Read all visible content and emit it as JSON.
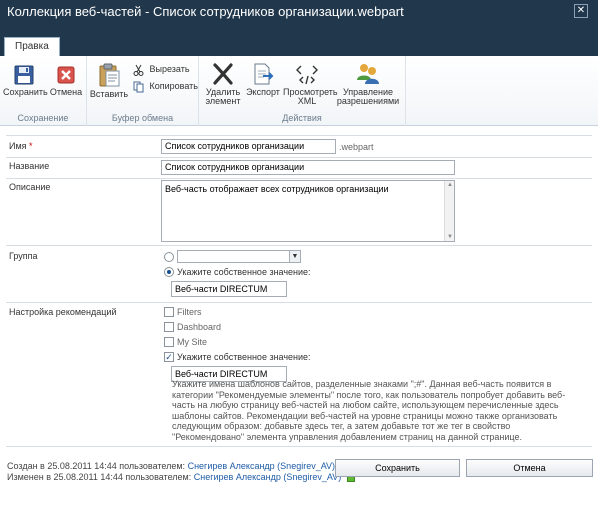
{
  "window": {
    "title": "Коллекция веб-частей - Список сотрудников организации.webpart",
    "close_glyph": "✕"
  },
  "ribbon": {
    "tab": "Правка",
    "groups": {
      "save": {
        "label": "Сохранение",
        "save": "Сохранить",
        "cancel": "Отмена"
      },
      "clipboard": {
        "label": "Буфер обмена",
        "paste": "Вставить",
        "cut": "Вырезать",
        "copy": "Копировать"
      },
      "actions": {
        "label": "Действия",
        "delete_line1": "Удалить",
        "delete_line2": "элемент",
        "export": "Экспорт",
        "viewxml_line1": "Просмотреть",
        "viewxml_line2": "XML",
        "perms_line1": "Управление",
        "perms_line2": "разрешениями"
      }
    }
  },
  "form": {
    "name": {
      "label": "Имя",
      "required_mark": "*",
      "value": "Список сотрудников организации",
      "suffix": ".webpart"
    },
    "title": {
      "label": "Название",
      "value": "Список сотрудников организации"
    },
    "description": {
      "label": "Описание",
      "value": "Веб-часть отображает всех сотрудников организации",
      "scroll_up": "▲",
      "scroll_down": "▼"
    },
    "group": {
      "label": "Группа",
      "select_value": "",
      "select_arrow": "▼",
      "custom_label": "Укажите собственное значение:",
      "custom_value": "Веб-части DIRECTUM"
    },
    "recommendations": {
      "label": "Настройка рекомендаций",
      "options": [
        "Filters",
        "Dashboard",
        "My Site"
      ],
      "custom_label": "Укажите собственное значение:",
      "custom_checked_glyph": "✓",
      "custom_value": "Веб-части DIRECTUM",
      "help_text": "Укажите имена шаблонов сайтов, разделенные знаками \";#\". Данная веб-часть появится в категории \"Рекомендуемые элементы\" после того, как пользователь попробует добавить веб-часть на любую страницу веб-частей на любом сайте, использующем перечисленные здесь шаблоны сайтов. Рекомендации веб-частей на уровне страницы можно также организовать следующим образом: добавьте здесь тег, а затем добавьте тот же тег в свойство \"Рекомендовано\" элемента управления добавлением страниц на данной странице."
    }
  },
  "footer": {
    "created_prefix": "Создан в 25.08.2011 14:44 пользователем:",
    "modified_prefix": "Изменен в 25.08.2011 14:44 пользователем:",
    "user": "Снегирев Александр (Snegirev_AV)",
    "save_button": "Сохранить",
    "cancel_button": "Отмена"
  }
}
